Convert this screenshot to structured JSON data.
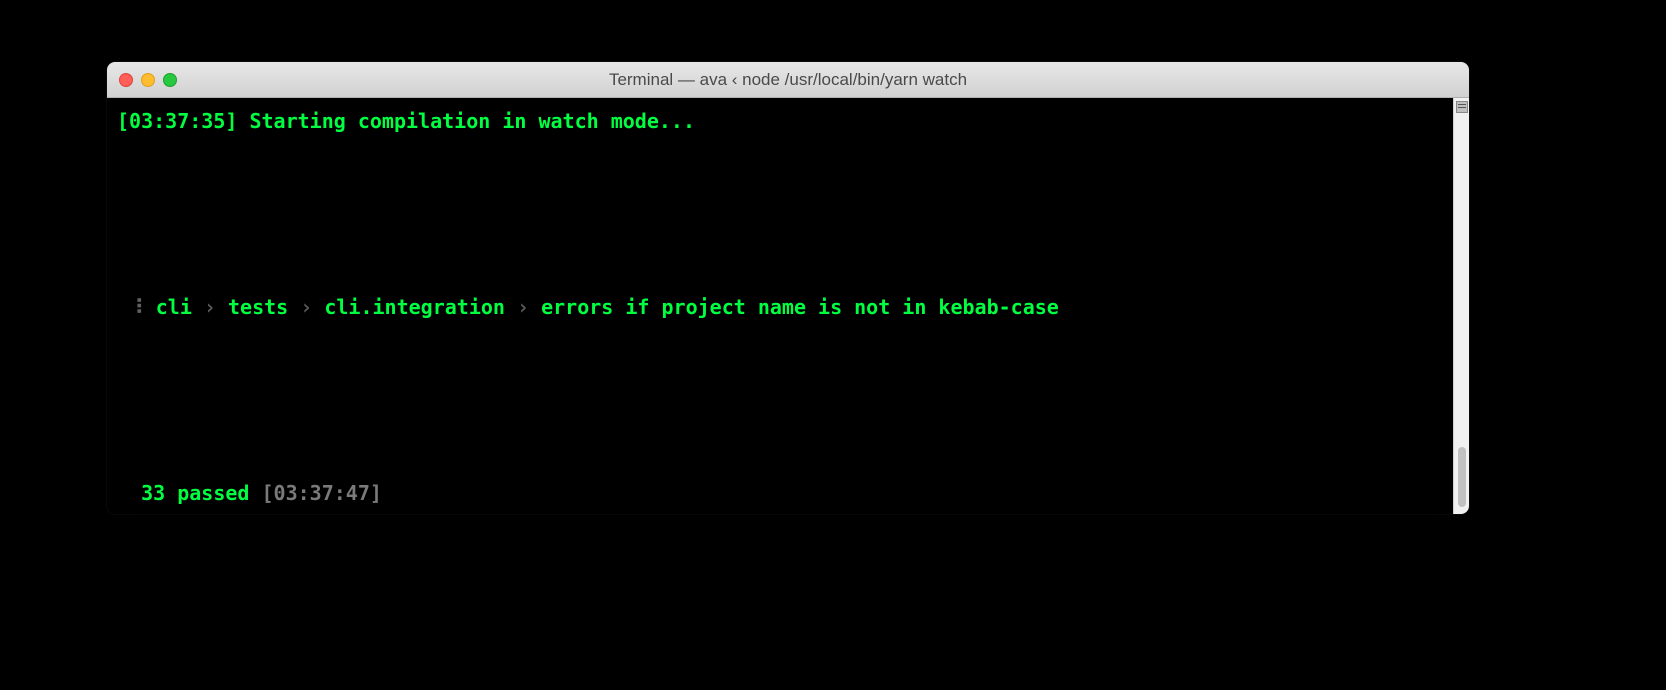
{
  "window": {
    "title": "Terminal — ava ‹ node /usr/local/bin/yarn watch"
  },
  "terminal": {
    "line1": {
      "timestamp_open": "[",
      "timestamp": "03:37:35",
      "timestamp_close": "]",
      "message": " Starting compilation in watch mode..."
    },
    "line2": {
      "spinner": " ⠸ ",
      "seg1": "cli",
      "sep1": " › ",
      "seg2": "tests",
      "sep2": " › ",
      "seg3": "cli.integration",
      "sep3": " › ",
      "seg4": "errors if project name is not in kebab-case"
    },
    "line3": {
      "pad": "  ",
      "passed": "33 passed ",
      "timestamp": "[03:37:47]"
    }
  }
}
